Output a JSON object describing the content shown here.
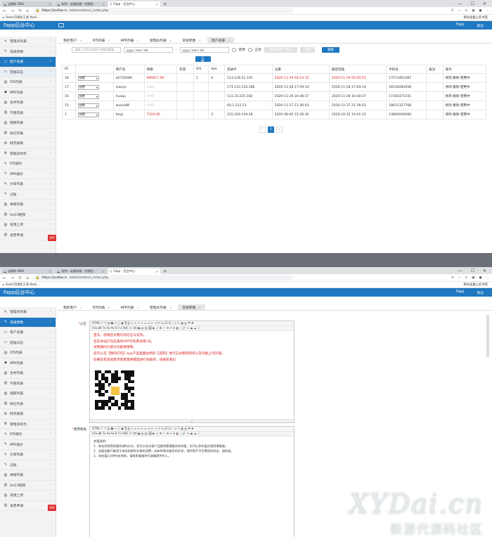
{
  "browser": {
    "tabs": [
      "云解析 DNS",
      "实例 - 云服务器 - 控制台",
      "Fapp - 后台中心"
    ],
    "url_host": "https://yssllw.cn",
    "url_path": "/admin/admin_index.php",
    "bookmark": "Redis可视化工具 Redi...",
    "bookmark_right": "移动设备上的书签"
  },
  "app": {
    "brand": "Fapp后台中心",
    "header_right": [
      "Fapp",
      "退出"
    ]
  },
  "screen1": {
    "sidebar": [
      {
        "icon": "✎",
        "label": "管理员列表"
      },
      {
        "icon": "✎",
        "label": "常规参数"
      },
      {
        "icon": "▭",
        "label": "客户名册"
      },
      {
        "icon": "▭",
        "label": "登陆日志"
      },
      {
        "icon": "▤",
        "label": "iOS列表"
      },
      {
        "icon": "◆",
        "label": "APK列表"
      },
      {
        "icon": "▥",
        "label": "合并列表"
      },
      {
        "icon": "▥",
        "label": "不跑列表"
      },
      {
        "icon": "▥",
        "label": "短链列表"
      },
      {
        "icon": "▥",
        "label": "防红列表"
      },
      {
        "icon": "⚙",
        "label": "财务报表"
      },
      {
        "icon": "⚙",
        "label": "管理员财务"
      },
      {
        "icon": "✎",
        "label": "IOS报价"
      },
      {
        "icon": "✎",
        "label": "APK报价"
      },
      {
        "icon": "✎",
        "label": "文章列表"
      },
      {
        "icon": "✎",
        "label": "记账"
      },
      {
        "icon": "▥",
        "label": "举报列表"
      },
      {
        "icon": "▥",
        "label": "ios13框架"
      },
      {
        "icon": "▥",
        "label": "资源上传"
      },
      {
        "icon": "▥",
        "label": "发票申请"
      }
    ],
    "tabs": [
      "我的客户",
      "iOS列表",
      "APK列表",
      "管理员列表",
      "常规参数",
      "客户名册"
    ],
    "filters": {
      "keyword_placeholder": "请输入手机号或用户名查询客服",
      "date_from": "yyyy / mm / dd",
      "date_to": "yyyy / mm / dd",
      "radio_banned": "禁用",
      "radio_normal": "正常",
      "level_select": "请选择用户等级",
      "level_btn": "全部",
      "search": "搜索",
      "all": "全部"
    },
    "table": {
      "headers": [
        "ID",
        "",
        "用户名",
        "余额",
        "充值",
        "iOS",
        "Apk",
        "登录IP",
        "注册",
        "最后登陆",
        "手机号",
        "备注",
        "操作"
      ],
      "rows": [
        {
          "id": "18",
          "tier": "快费",
          "user": "a6718589",
          "balance": "995817.00",
          "recharge": "",
          "ios": "1",
          "apk": "4",
          "ip": "113.128.22.101",
          "reg": "2020-11-29 04:14:15",
          "last": "2020-11-29 05:00:52",
          "phone": "17573461487",
          "note": "",
          "ops": "修改 删除 使用中"
        },
        {
          "id": "17",
          "tier": "快费",
          "user": "xiaoya",
          "balance": "0.00",
          "recharge": "",
          "ios": "",
          "apk": "",
          "ip": "171.110.135.186",
          "reg": "2020-11-28 17:09:14",
          "last": "2020-11-28 17:09:14",
          "phone": "16534084058",
          "note": "",
          "ops": "修改 删除 使用中"
        },
        {
          "id": "16",
          "tier": "快费",
          "user": "huoqu",
          "balance": "0.00",
          "recharge": "",
          "ios": "",
          "apk": "",
          "ip": "111.33.225.182",
          "reg": "2020-11-28 16:48:37",
          "last": "2020-11-28 16:48:37",
          "phone": "17181471541",
          "note": "",
          "ops": "修改 删除 使用中"
        },
        {
          "id": "15",
          "tier": "快费",
          "user": "wuluo88",
          "balance": "0.00",
          "recharge": "",
          "ios": "",
          "apk": "",
          "ip": "60.1.212.21",
          "reg": "2020-11-27 21:36:03",
          "last": "2020-11-27 21:36:03",
          "phone": "18631157768",
          "note": "",
          "ops": "修改 删除 使用中"
        },
        {
          "id": "1",
          "tier": "快费",
          "user": "fang",
          "balance": "7410.00",
          "recharge": "",
          "ios": "",
          "apk": "3",
          "ip": "222.209.149.28",
          "reg": "2020-08-06 15:26:30",
          "last": "2020-10-25 16:41:15",
          "phone": "13800000000",
          "note": "",
          "ops": "修改 删除 使用中"
        }
      ]
    },
    "pager": [
      "‹",
      "1",
      "›"
    ],
    "badge": "返回"
  },
  "screen2": {
    "tabs": [
      "我的客户",
      "iOS列表",
      "APK列表",
      "管理员列表",
      "常规参数"
    ],
    "editor1_label": "公告",
    "editor2_label": "使用帮助",
    "toolbar": "HTML ↶ ↷ 🖫 🖨 ✂ ▢ ▣ ⎘ ⎙ ≡ ≡ ≡ ≡ ≔ ≕ ⇤ ⇥ x² x₂ Ω ☺ ⛶ ⌂ ✎ ▦ ▤ ⚑ ✚",
    "toolbar2": "H1▾ 𝓕▾ T▾ A▾ A▾ B I U ABC ☷ ⌫ ▣ ▤ ▥ 🖼 ▶ ♫ ⌘ ⚐ ☰ ✦ ⊞ ◧ ─ 🔗 ⚓ ⏏ ☁ ⓘ",
    "notice_lines": [
      "首先，感谢您对我们的信任与支持。",
      "您在本站打包出来的APP可免费试用1天。",
      "试用期间大部分功能受限制。",
      "您可以在【我的打包】app产品里面右侧的【选购】进行正式版的购买以及功能上的升级。",
      "如果您有其他需求或者需要都是进行协助的，请联系我们"
    ],
    "help_lines": [
      "充值说明：",
      "1、本站采用预充值扣减的方式，您可以先对某产品使用便捷服务的充值，也可以多先盘应相用增值服。",
      "2、充值金额只能用于本站的即时兑换的消费，如有特殊功能性的开发，预付款不予为费用的扣金，请知悉。",
      "3、如充值1分钟内未到账，请联系客服的行政事提供付人。"
    ]
  },
  "watermark": {
    "latin": "XYDai.cn",
    "cn": "新源代源码社区"
  }
}
